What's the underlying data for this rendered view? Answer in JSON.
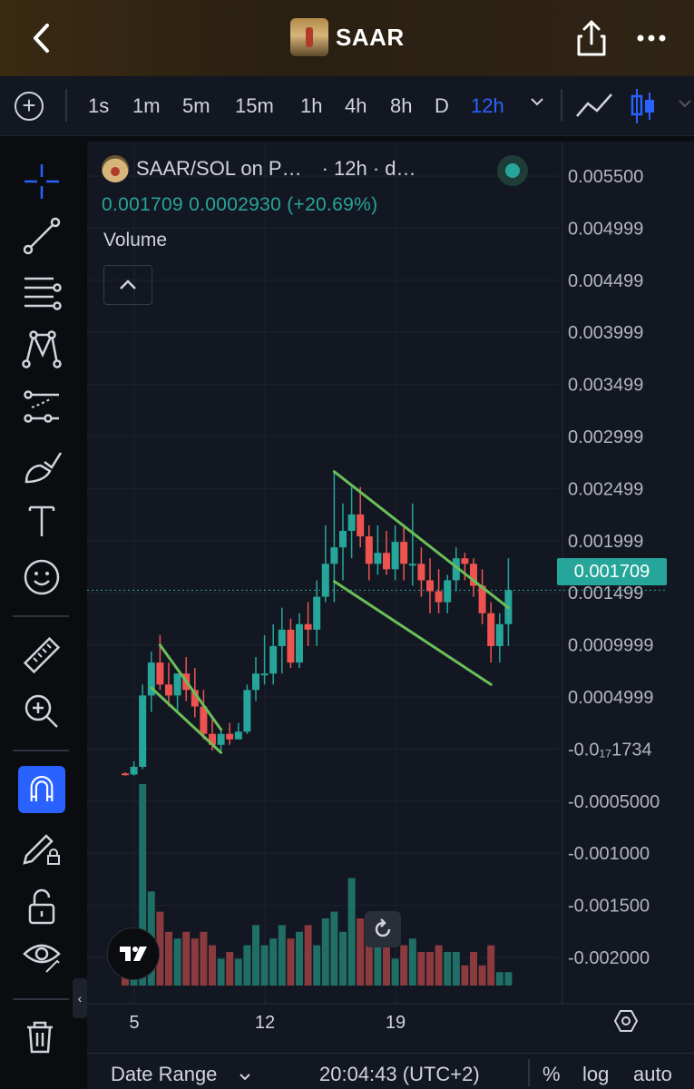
{
  "header": {
    "back_icon": "chevron-left-icon",
    "title": "SAAR",
    "share_icon": "share-icon",
    "more_icon": "more-horizontal-icon"
  },
  "timeframes": {
    "items": [
      "1s",
      "1m",
      "5m",
      "15m",
      "1h",
      "4h",
      "8h",
      "D",
      "12h"
    ],
    "active": "12h",
    "dropdown_icon": "chevron-down-icon",
    "chart_type_icons": [
      "line-chart-icon",
      "candles-icon"
    ]
  },
  "tools": [
    "crosshair-icon",
    "trendline-icon",
    "fib-icon",
    "pattern-icon",
    "prediction-icon",
    "brush-icon",
    "text-icon",
    "emoji-icon",
    "ruler-icon",
    "zoom-icon",
    "magnet-icon",
    "lock-draw-icon",
    "unlock-icon",
    "eye-icon",
    "trash-icon"
  ],
  "legend": {
    "symbol": "SAAR/SOL on P…",
    "interval": "· 12h · d…",
    "ohlc_line": "0.001709  0.0002930 (+20.69%)",
    "volume_label": "Volume",
    "collapse": "^"
  },
  "price_axis": {
    "labels": [
      "0.005500",
      "0.004999",
      "0.004499",
      "0.003999",
      "0.003499",
      "0.002999",
      "0.002499",
      "0.001999",
      "0.001499",
      "0.0009999",
      "0.0004999",
      "-0.0₁₇1734",
      "-0.0005000",
      "-0.001000",
      "-0.001500",
      "-0.002000"
    ],
    "current_price": "0.001709"
  },
  "time_axis": {
    "labels": [
      "5",
      "12",
      "19"
    ]
  },
  "bottom": {
    "date_range": "Date Range",
    "date_range_icon": "chevron-down-icon",
    "time": "20:04:43 (UTC+2)",
    "percent": "%",
    "log": "log",
    "auto": "auto"
  },
  "colors": {
    "up": "#26a69a",
    "down": "#ef5350",
    "accent": "#2962ff",
    "trendline": "#6bbf59"
  },
  "chart_data": {
    "type": "candlestick",
    "candles": [
      {
        "o": 4e-05,
        "h": 5e-05,
        "l": 2e-05,
        "c": 3e-05
      },
      {
        "o": 3e-05,
        "h": 0.00015,
        "l": 2e-05,
        "c": 0.0001
      },
      {
        "o": 0.0001,
        "h": 0.00085,
        "l": 8e-05,
        "c": 0.00075
      },
      {
        "o": 0.00075,
        "h": 0.00115,
        "l": 0.0006,
        "c": 0.00105
      },
      {
        "o": 0.00105,
        "h": 0.0013,
        "l": 0.0008,
        "c": 0.00085
      },
      {
        "o": 0.00085,
        "h": 0.00105,
        "l": 0.00065,
        "c": 0.00075
      },
      {
        "o": 0.00075,
        "h": 0.00095,
        "l": 0.0006,
        "c": 0.00095
      },
      {
        "o": 0.00095,
        "h": 0.0011,
        "l": 0.0007,
        "c": 0.0008
      },
      {
        "o": 0.0008,
        "h": 0.001,
        "l": 0.00055,
        "c": 0.00065
      },
      {
        "o": 0.00065,
        "h": 0.0008,
        "l": 0.00035,
        "c": 0.0004
      },
      {
        "o": 0.0004,
        "h": 0.00055,
        "l": 0.00025,
        "c": 0.0003
      },
      {
        "o": 0.0003,
        "h": 0.00045,
        "l": 0.00025,
        "c": 0.0004
      },
      {
        "o": 0.0004,
        "h": 0.0005,
        "l": 0.0003,
        "c": 0.00035
      },
      {
        "o": 0.00035,
        "h": 0.0005,
        "l": 0.00035,
        "c": 0.00042
      },
      {
        "o": 0.00042,
        "h": 0.00085,
        "l": 0.0004,
        "c": 0.0008
      },
      {
        "o": 0.0008,
        "h": 0.0011,
        "l": 0.0007,
        "c": 0.00095
      },
      {
        "o": 0.00095,
        "h": 0.0013,
        "l": 0.00085,
        "c": 0.00095
      },
      {
        "o": 0.00095,
        "h": 0.0014,
        "l": 0.00085,
        "c": 0.0012
      },
      {
        "o": 0.0012,
        "h": 0.00155,
        "l": 0.00095,
        "c": 0.00135
      },
      {
        "o": 0.00135,
        "h": 0.00145,
        "l": 0.001,
        "c": 0.00105
      },
      {
        "o": 0.00105,
        "h": 0.0015,
        "l": 0.001,
        "c": 0.0014
      },
      {
        "o": 0.0014,
        "h": 0.0016,
        "l": 0.0012,
        "c": 0.00135
      },
      {
        "o": 0.00135,
        "h": 0.0018,
        "l": 0.0012,
        "c": 0.00165
      },
      {
        "o": 0.00165,
        "h": 0.0023,
        "l": 0.0016,
        "c": 0.00195
      },
      {
        "o": 0.00195,
        "h": 0.0028,
        "l": 0.0016,
        "c": 0.0021
      },
      {
        "o": 0.0021,
        "h": 0.0025,
        "l": 0.0018,
        "c": 0.00225
      },
      {
        "o": 0.00225,
        "h": 0.00265,
        "l": 0.002,
        "c": 0.0024
      },
      {
        "o": 0.0024,
        "h": 0.00265,
        "l": 0.0021,
        "c": 0.0022
      },
      {
        "o": 0.0022,
        "h": 0.0023,
        "l": 0.0018,
        "c": 0.00195
      },
      {
        "o": 0.00195,
        "h": 0.0023,
        "l": 0.00185,
        "c": 0.00205
      },
      {
        "o": 0.00205,
        "h": 0.00225,
        "l": 0.00185,
        "c": 0.0019
      },
      {
        "o": 0.0019,
        "h": 0.0023,
        "l": 0.0018,
        "c": 0.00215
      },
      {
        "o": 0.00215,
        "h": 0.0023,
        "l": 0.0018,
        "c": 0.00195
      },
      {
        "o": 0.00195,
        "h": 0.0025,
        "l": 0.00175,
        "c": 0.00195
      },
      {
        "o": 0.00195,
        "h": 0.0021,
        "l": 0.00165,
        "c": 0.0018
      },
      {
        "o": 0.0018,
        "h": 0.002,
        "l": 0.0015,
        "c": 0.0017
      },
      {
        "o": 0.0017,
        "h": 0.0019,
        "l": 0.0015,
        "c": 0.0016
      },
      {
        "o": 0.0016,
        "h": 0.00185,
        "l": 0.0015,
        "c": 0.0018
      },
      {
        "o": 0.0018,
        "h": 0.0021,
        "l": 0.0017,
        "c": 0.002
      },
      {
        "o": 0.002,
        "h": 0.00205,
        "l": 0.0018,
        "c": 0.00195
      },
      {
        "o": 0.00195,
        "h": 0.002,
        "l": 0.00165,
        "c": 0.00175
      },
      {
        "o": 0.00175,
        "h": 0.0019,
        "l": 0.0014,
        "c": 0.0015
      },
      {
        "o": 0.0015,
        "h": 0.0016,
        "l": 0.00105,
        "c": 0.0012
      },
      {
        "o": 0.0012,
        "h": 0.0015,
        "l": 0.00105,
        "c": 0.0014
      },
      {
        "o": 0.0014,
        "h": 0.002,
        "l": 0.0012,
        "c": 0.00171
      }
    ],
    "volume": [
      2,
      4,
      30,
      14,
      11,
      8,
      7,
      8,
      7,
      8,
      6,
      4,
      5,
      4,
      6,
      9,
      6,
      7,
      9,
      7,
      8,
      9,
      6,
      10,
      11,
      8,
      16,
      10,
      8,
      9,
      7,
      4,
      6,
      7,
      5,
      5,
      6,
      5,
      5,
      3,
      5,
      3,
      6,
      2,
      2
    ],
    "trendlines": [
      {
        "x1": 4,
        "y1": 0.00121,
        "x2": 11,
        "y2": 0.00044
      },
      {
        "x1": 3,
        "y1": 0.00082,
        "x2": 11,
        "y2": 0.00023
      },
      {
        "x1": 24,
        "y1": 0.00279,
        "x2": 44,
        "y2": 0.00155
      },
      {
        "x1": 24,
        "y1": 0.00179,
        "x2": 42,
        "y2": 0.00085
      }
    ],
    "ylim": [
      -0.0024,
      0.0058
    ]
  }
}
